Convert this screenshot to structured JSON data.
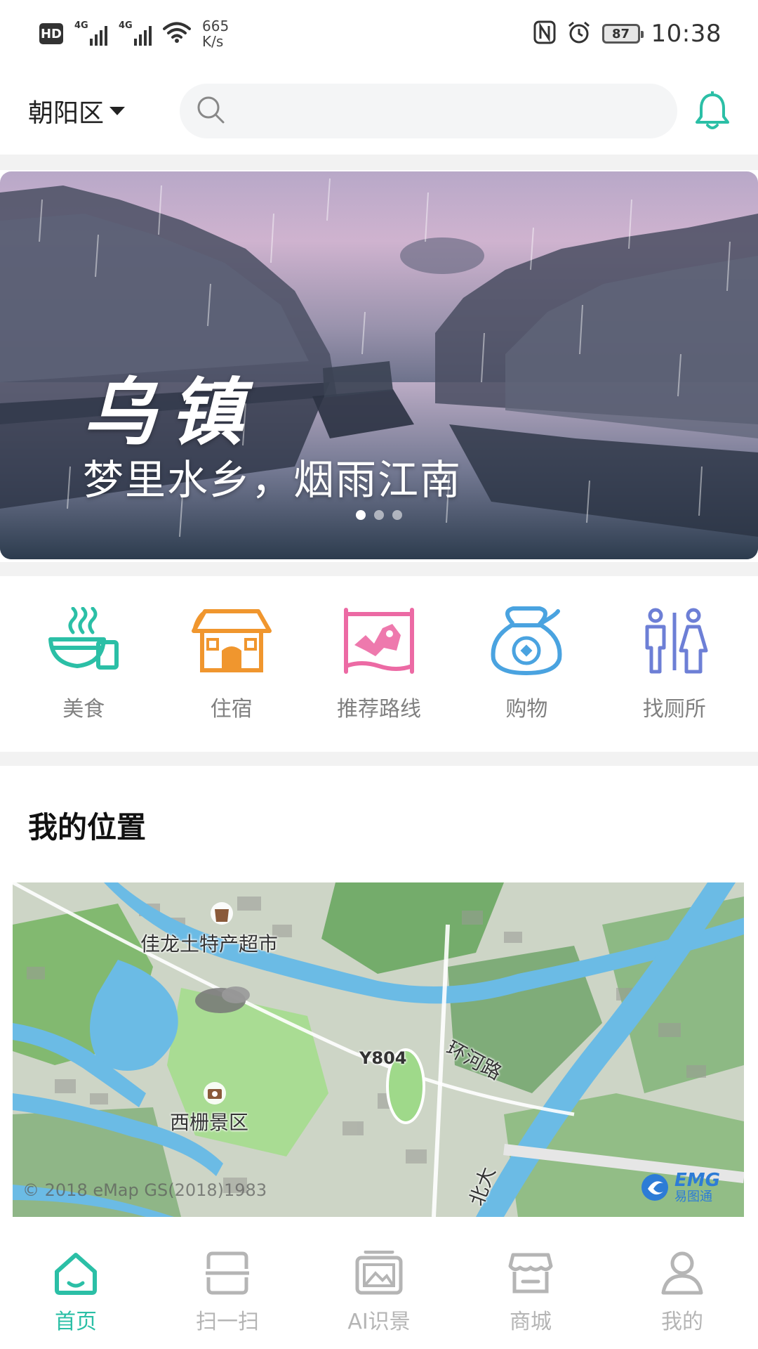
{
  "status_bar": {
    "hd": "HD",
    "signal1_tag": "4G",
    "signal2_tag": "4G",
    "net_speed_value": "665",
    "net_speed_unit": "K/s",
    "battery": "87",
    "time": "10:38"
  },
  "header": {
    "district": "朝阳区",
    "search_placeholder": ""
  },
  "banner": {
    "title": "乌镇",
    "subtitle": "梦里水乡，烟雨江南",
    "dots": 3,
    "active_dot": 0
  },
  "categories": [
    {
      "label": "美食",
      "icon": "food-bowl-icon",
      "color": "#2bbfa6"
    },
    {
      "label": "住宿",
      "icon": "lodging-house-icon",
      "color": "#f0962e"
    },
    {
      "label": "推荐路线",
      "icon": "route-map-icon",
      "color": "#ec6aa4"
    },
    {
      "label": "购物",
      "icon": "shopping-bag-icon",
      "color": "#4aa3e0"
    },
    {
      "label": "找厕所",
      "icon": "restroom-icon",
      "color": "#6d7fd6"
    }
  ],
  "location": {
    "title": "我的位置",
    "map_labels": {
      "poi_market": "佳龙土特产超市",
      "poi_scenic": "西栅景区",
      "road_id": "Y804",
      "road_name": "环河路",
      "road_partial": "北大"
    },
    "map_copyright": "© 2018 eMap GS(2018)1983",
    "logo_text": "EMG",
    "logo_cn": "易图通"
  },
  "bottom_nav": [
    {
      "label": "首页",
      "icon": "home-icon",
      "active": true
    },
    {
      "label": "扫一扫",
      "icon": "scan-icon",
      "active": false
    },
    {
      "label": "AI识景",
      "icon": "ai-scene-icon",
      "active": false
    },
    {
      "label": "商城",
      "icon": "store-icon",
      "active": false
    },
    {
      "label": "我的",
      "icon": "profile-icon",
      "active": false
    }
  ],
  "colors": {
    "accent": "#2bbfa6",
    "inactive_nav": "#b5b5b5",
    "category_label": "#808080"
  }
}
